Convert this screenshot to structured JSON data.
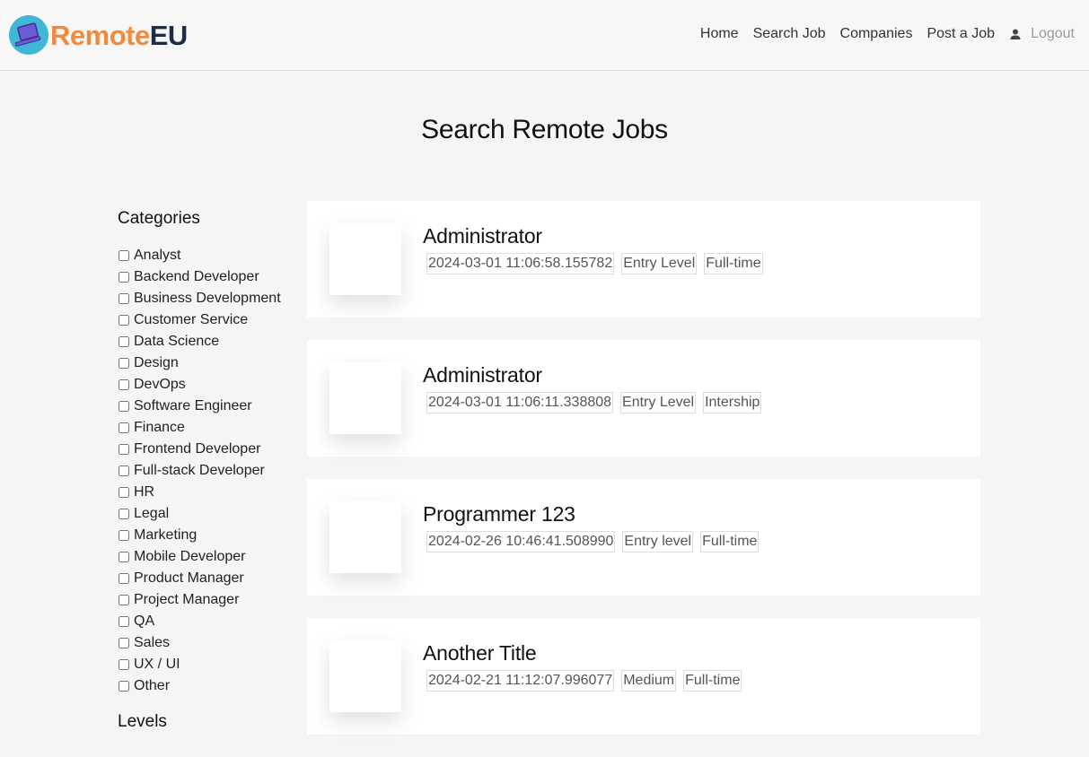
{
  "logo": {
    "part1": "Remote",
    "part2": "EU"
  },
  "nav": {
    "home": "Home",
    "search": "Search Job",
    "companies": "Companies",
    "post": "Post a Job",
    "logout": "Logout"
  },
  "page_title": "Search Remote Jobs",
  "sidebar": {
    "categories_heading": "Categories",
    "categories": [
      "Analyst",
      "Backend Developer",
      "Business Development",
      "Customer Service",
      "Data Science",
      "Design",
      "DevOps",
      "Software Engineer",
      "Finance",
      "Frontend Developer",
      "Full-stack Developer",
      "HR",
      "Legal",
      "Marketing",
      "Mobile Developer",
      "Product Manager",
      "Project Manager",
      "QA",
      "Sales",
      "UX / UI",
      "Other"
    ],
    "levels_heading": "Levels"
  },
  "jobs": [
    {
      "title": "Administrator",
      "date": "2024-03-01 11:06:58.155782",
      "level": "Entry Level",
      "type": "Full-time"
    },
    {
      "title": "Administrator",
      "date": "2024-03-01 11:06:11.338808",
      "level": "Entry Level",
      "type": "Intership"
    },
    {
      "title": "Programmer 123",
      "date": "2024-02-26 10:46:41.508990",
      "level": "Entry level",
      "type": "Full-time"
    },
    {
      "title": "Another Title",
      "date": "2024-02-21 11:12:07.996077",
      "level": "Medium",
      "type": "Full-time"
    }
  ],
  "colors": {
    "brand_orange": "#f08a3c",
    "brand_navy": "#1c2d4a",
    "logo_circle": "#3fb7d6"
  },
  "icons": {
    "user": "user-icon",
    "logo": "laptop-logo-icon"
  }
}
